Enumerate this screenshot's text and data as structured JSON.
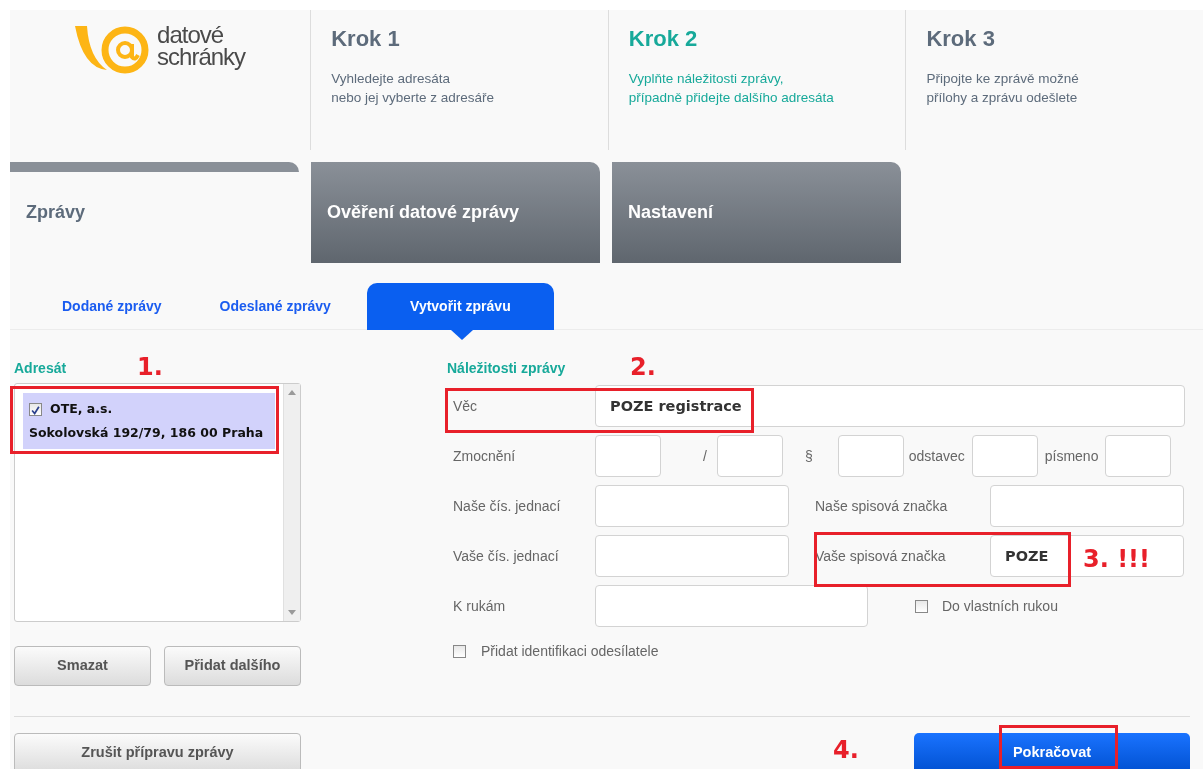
{
  "header": {
    "logo": {
      "line1": "datové",
      "line2": "schránky"
    },
    "steps": [
      {
        "title": "Krok 1",
        "lines": [
          "Vyhledejte adresáta",
          "nebo jej vyberte z adresáře"
        ],
        "selected": false
      },
      {
        "title": "Krok 2",
        "lines": [
          "Vyplňte náležitosti zprávy,",
          "případně přidejte dalšího adresáta"
        ],
        "selected": true
      },
      {
        "title": "Krok 3",
        "lines": [
          "Připojte ke zprávě možné",
          "přílohy a zprávu odešlete"
        ],
        "selected": false
      }
    ]
  },
  "main_tabs": [
    {
      "label": "Zprávy",
      "selected": true
    },
    {
      "label": "Ověření datové zprávy",
      "selected": false
    },
    {
      "label": "Nastavení",
      "selected": false
    }
  ],
  "sub_tabs": [
    {
      "label": "Dodané zprávy",
      "selected": false
    },
    {
      "label": "Odeslané zprávy",
      "selected": false
    },
    {
      "label": "Vytvořit zprávu",
      "selected": true
    }
  ],
  "recipient": {
    "heading": "Adresát",
    "items": [
      {
        "name": "OTE, a.s.",
        "address": "Sokolovská 192/79, 186 00 Praha",
        "checked": true,
        "selected": true
      }
    ],
    "buttons": [
      "Smazat",
      "Přidat dalšího"
    ]
  },
  "details": {
    "heading": "Náležitosti zprávy",
    "subject": {
      "label": "Věc",
      "value": "POZE registrace"
    },
    "authorization": {
      "label": "Zmocnění",
      "separators": [
        "/",
        "§",
        "odstavec",
        "písmeno"
      ]
    },
    "pairs": [
      {
        "left_label": "Naše čís. jednací",
        "right_label": "Naše spisová značka"
      },
      {
        "left_label": "Vaše čís. jednací",
        "right_label": "Vaše spisová značka",
        "right_value": "POZE"
      }
    ],
    "hands": {
      "label": "K rukám",
      "option": {
        "label": "Do vlastních rukou",
        "checked": false
      }
    },
    "sender_id": {
      "label": "Přidat identifikaci odesílatele",
      "checked": false
    }
  },
  "footer": {
    "cancel": "Zrušit přípravu zprávy",
    "continue": "Pokračovat"
  },
  "annotations": [
    {
      "text": "1."
    },
    {
      "text": "2."
    },
    {
      "text": "3. !!!"
    },
    {
      "text": "4."
    }
  ]
}
